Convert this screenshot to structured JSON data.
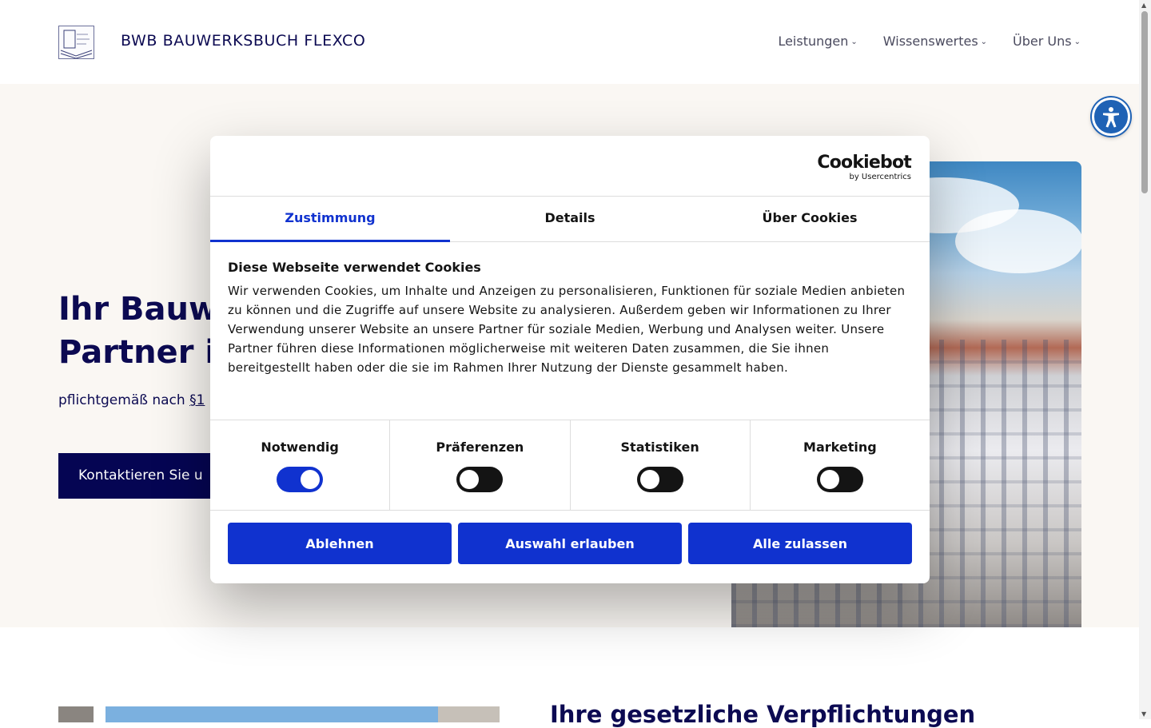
{
  "header": {
    "brand": "BWB BAUWERKSBUCH FLEXCO",
    "nav": [
      {
        "label": "Leistungen"
      },
      {
        "label": "Wissenswertes"
      },
      {
        "label": "Über Uns"
      }
    ]
  },
  "hero": {
    "title_line1": "Ihr Bauwe",
    "title_line2": "Partner in",
    "subtitle_text": "pflichtgemäß nach ",
    "subtitle_link": "§1",
    "cta_label": "Kontaktieren Sie u"
  },
  "lower": {
    "title": "Ihre gesetzliche Verpflichtungen"
  },
  "cookie": {
    "logo_word": "Cookiebot",
    "logo_by": "by Usercentrics",
    "tabs": [
      {
        "label": "Zustimmung"
      },
      {
        "label": "Details"
      },
      {
        "label": "Über Cookies"
      }
    ],
    "heading": "Diese Webseite verwendet Cookies",
    "body": "Wir verwenden Cookies, um Inhalte und Anzeigen zu personalisieren, Funktionen für soziale Medien anbieten zu können und die Zugriffe auf unsere Website zu analysieren. Außerdem geben wir Informationen zu Ihrer Verwendung unserer Website an unsere Partner für soziale Medien, Werbung und Analysen weiter. Unsere Partner führen diese Informationen möglicherweise mit weiteren Daten zusammen, die Sie ihnen bereitgestellt haben oder die sie im Rahmen Ihrer Nutzung der Dienste gesammelt haben.",
    "categories": [
      {
        "label": "Notwendig",
        "enabled": true
      },
      {
        "label": "Präferenzen",
        "enabled": false
      },
      {
        "label": "Statistiken",
        "enabled": false
      },
      {
        "label": "Marketing",
        "enabled": false
      }
    ],
    "buttons": {
      "reject": "Ablehnen",
      "allow_selection": "Auswahl erlauben",
      "allow_all": "Alle zulassen"
    }
  },
  "colors": {
    "accent_blue": "#1032cf",
    "navy": "#050553",
    "hero_bg": "#faf7f3"
  },
  "icons": {
    "accessibility": "accessibility-icon",
    "chevron": "chevron-down-icon"
  }
}
